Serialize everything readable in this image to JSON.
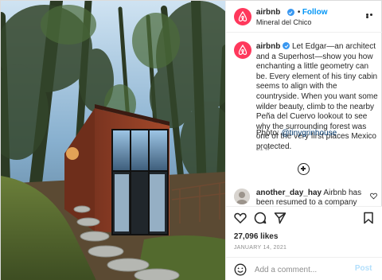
{
  "colors": {
    "brand": "#ff385c",
    "link": "#0095f6",
    "verified": "#3897f0",
    "muted": "#8e8e8e",
    "post_disabled": "#b2dffc"
  },
  "photo": {
    "icon": "cabin-photo"
  },
  "header": {
    "username": "airbnb",
    "separator": "•",
    "follow_label": "Follow",
    "location": "Mineral del Chico",
    "more_icon": "more-icon"
  },
  "caption": {
    "username": "airbnb",
    "text": "Let Edgar—an architect and a Superhost—show you how enchanting a little geometry can be. Every element of his tiny cabin seems to align with the countryside. When you want some wilder beauty, climb to the nearby Peña del Cuervo lookout to see why the surrounding forest was one of the very first places Mexico protected.",
    "photo_prefix": "Photo: ",
    "photo_credit": "@tinygrinhouse",
    "time_ago": "51 w"
  },
  "comment": {
    "username": "another_day_hay",
    "text": "Airbnb has been resumed to a company which will"
  },
  "actions": {
    "icons": [
      "heart-icon",
      "comment-icon",
      "share-icon",
      "bookmark-icon"
    ],
    "likes": "27,096 likes",
    "date": "JANUARY 14, 2021"
  },
  "add_comment": {
    "placeholder": "Add a comment...",
    "post_label": "Post"
  }
}
